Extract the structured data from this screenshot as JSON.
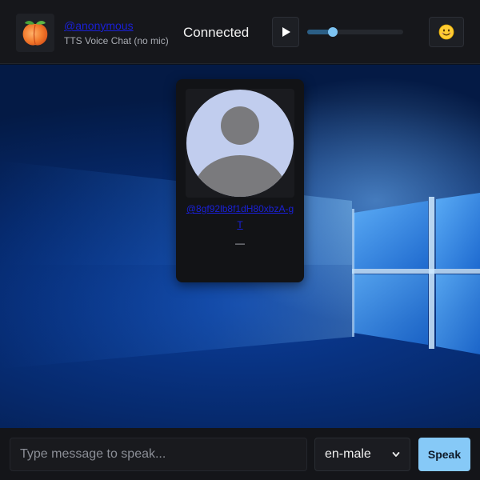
{
  "header": {
    "username": "@anonymous",
    "subtitle": "TTS Voice Chat (no mic)",
    "status": "Connected",
    "play_icon": "play-icon",
    "volume_level": 0.27,
    "emoji_button": "😊",
    "logo_icon": "peach-icon"
  },
  "peer": {
    "name": "@8gf92lb8f1dH80xbzA-gT",
    "status": "—",
    "avatar_icon": "default-avatar-icon"
  },
  "footer": {
    "message_placeholder": "Type message to speak...",
    "message_value": "",
    "voice_selected": "en-male",
    "speak_label": "Speak"
  },
  "colors": {
    "accent": "#86c9f7",
    "link": "#1a20d6",
    "header_bg": "#16171b",
    "card_bg": "#121316"
  }
}
